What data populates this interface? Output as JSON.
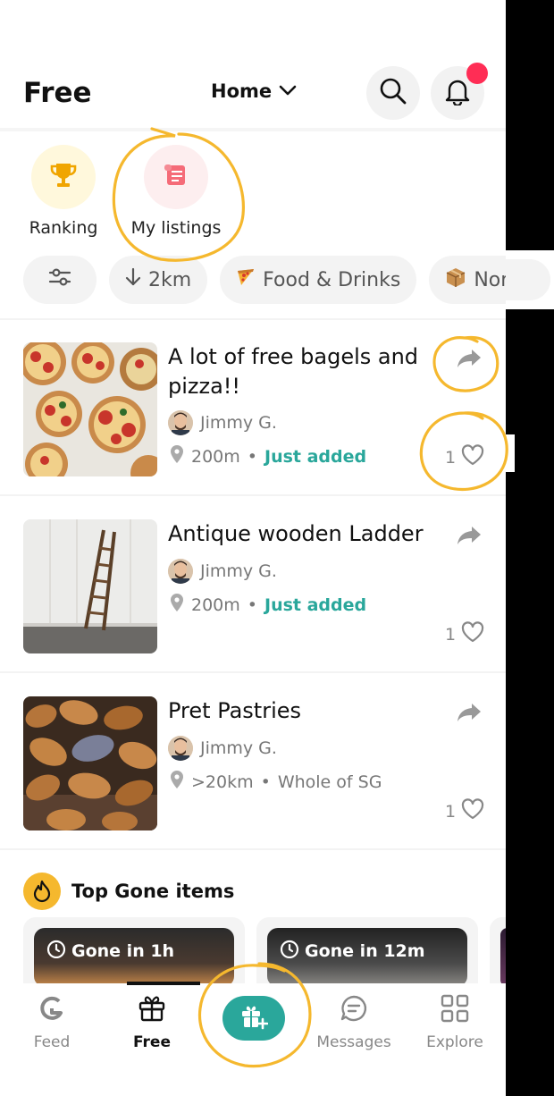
{
  "header": {
    "app_title": "Free",
    "home_label": "Home"
  },
  "shortcuts": [
    {
      "label": "Ranking",
      "icon": "trophy-icon"
    },
    {
      "label": "My listings",
      "icon": "scroll-icon"
    }
  ],
  "filters": [
    {
      "label": "",
      "icon": "sliders-icon"
    },
    {
      "label": "2km",
      "icon": "arrow-down-icon"
    },
    {
      "label": "Food & Drinks",
      "icon": "pizza-icon"
    },
    {
      "label": "Non-food",
      "icon": "package-icon"
    }
  ],
  "listings": [
    {
      "title": "A lot of free bagels and pizza!!",
      "user": "Jimmy G.",
      "distance": "200m",
      "tag": "Just added",
      "likes": "1"
    },
    {
      "title": "Antique wooden Ladder",
      "user": "Jimmy G.",
      "distance": "200m",
      "tag": "Just added",
      "likes": "1"
    },
    {
      "title": "Pret Pastries",
      "user": "Jimmy G.",
      "distance": ">20km",
      "tag": "Whole of SG",
      "likes": "1"
    }
  ],
  "top_gone": {
    "title": "Top Gone items",
    "cards": [
      {
        "badge": "Gone in 1h"
      },
      {
        "badge": "Gone in 12m"
      }
    ]
  },
  "nav": {
    "feed": "Feed",
    "free": "Free",
    "messages": "Messages",
    "explore": "Explore"
  },
  "colors": {
    "accent": "#2aa79b",
    "notification": "#ff2d55",
    "annotation": "#f5b82e"
  }
}
